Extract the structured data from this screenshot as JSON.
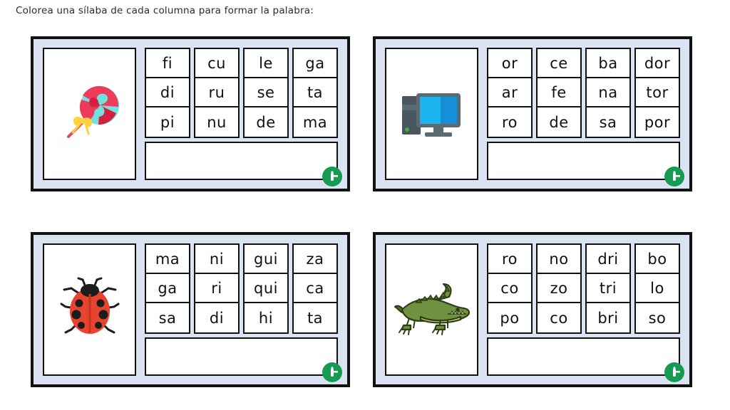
{
  "header": {
    "instruction": "Colorea una sílaba de cada columna para formar la palabra:"
  },
  "colors": {
    "card_background": "#dbe2f2",
    "card_border": "#111111",
    "cell_background": "#ffffff",
    "badge_green": "#169b52",
    "page_background": "#ffffff"
  },
  "badge": {
    "icon": "logo-badge-icon"
  },
  "cards": [
    {
      "id": "card-piruleta",
      "picture": {
        "icon": "lollipop-icon",
        "label": "piruleta",
        "colors": {
          "swirl_pink": "#ef3b5b",
          "swirl_cyan": "#72e0dc",
          "stick": "#e8445f",
          "bow": "#ffd23f"
        }
      },
      "columns": [
        {
          "syllables": [
            "fi",
            "di",
            "pi"
          ]
        },
        {
          "syllables": [
            "cu",
            "ru",
            "nu"
          ]
        },
        {
          "syllables": [
            "le",
            "se",
            "de"
          ]
        },
        {
          "syllables": [
            "ga",
            "ta",
            "ma"
          ]
        }
      ],
      "answer": ""
    },
    {
      "id": "card-ordenador",
      "picture": {
        "icon": "desktop-computer-icon",
        "label": "ordenador",
        "colors": {
          "tower": "#4a565e",
          "screen": "#1ab4f0",
          "screen_dark": "#1590d8",
          "bezel": "#5c6b73",
          "led": "#3fae46"
        }
      },
      "columns": [
        {
          "syllables": [
            "or",
            "ar",
            "ro"
          ]
        },
        {
          "syllables": [
            "ce",
            "fe",
            "de"
          ]
        },
        {
          "syllables": [
            "ba",
            "na",
            "sa"
          ]
        },
        {
          "syllables": [
            "dor",
            "tor",
            "por"
          ]
        }
      ],
      "answer": ""
    },
    {
      "id": "card-mariquita",
      "picture": {
        "icon": "ladybug-icon",
        "label": "mariquita",
        "colors": {
          "body": "#e8432e",
          "spots": "#1c1c1c",
          "head": "#1c1c1c",
          "legs": "#1c1c1c"
        }
      },
      "columns": [
        {
          "syllables": [
            "ma",
            "ga",
            "sa"
          ]
        },
        {
          "syllables": [
            "ni",
            "ri",
            "di"
          ]
        },
        {
          "syllables": [
            "gui",
            "qui",
            "hi"
          ]
        },
        {
          "syllables": [
            "za",
            "ca",
            "ta"
          ]
        }
      ],
      "answer": ""
    },
    {
      "id": "card-cocodrilo",
      "picture": {
        "icon": "crocodile-icon",
        "label": "cocodrilo",
        "colors": {
          "body": "#6e9241",
          "body_dark": "#56752f",
          "belly": "#ccd97a",
          "outline": "#2f3d17"
        }
      },
      "columns": [
        {
          "syllables": [
            "ro",
            "co",
            "po"
          ]
        },
        {
          "syllables": [
            "no",
            "zo",
            "co"
          ]
        },
        {
          "syllables": [
            "dri",
            "tri",
            "bri"
          ]
        },
        {
          "syllables": [
            "bo",
            "lo",
            "so"
          ]
        }
      ],
      "answer": ""
    }
  ]
}
